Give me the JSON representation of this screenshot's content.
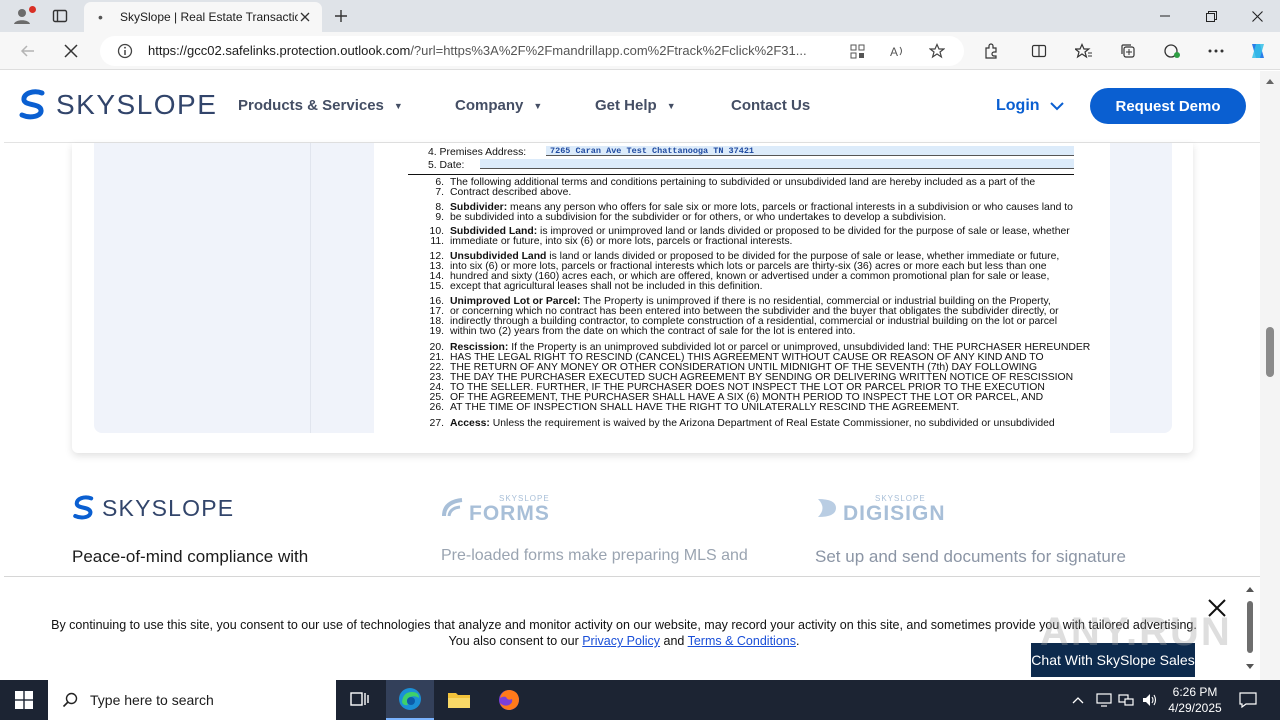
{
  "browser": {
    "tab_title": "SkySlope | Real Estate Transaction",
    "tab_favicon": "•",
    "url_host": "https://gcc02.safelinks.protection.outlook.com",
    "url_rest": "/?url=https%3A%2F%2Fmandrillapp.com%2Ftrack%2Fclick%2F31..."
  },
  "header": {
    "logo_text": "SKYSLOPE",
    "nav": [
      "Products & Services",
      "Company",
      "Get Help",
      "Contact Us"
    ],
    "login_label": "Login",
    "demo_label": "Request Demo",
    "brand_color": "#0a5fd1"
  },
  "doc": {
    "line4_label": "4.   Premises Address:",
    "line4_value": "7265 Caran Ave Test Chattanooga TN 37421",
    "line5_label": "5.   Date:",
    "lines": [
      {
        "n": "6.",
        "t": "The following additional terms and conditions pertaining to subdivided or unsubdivided land are hereby included as a part of the"
      },
      {
        "n": "7.",
        "t": "Contract described above."
      },
      {
        "n": "8.",
        "b": "Subdivider:",
        "t": " means any person who offers for sale six or more lots, parcels or fractional interests in a subdivision or who causes land to"
      },
      {
        "n": "9.",
        "t": "be subdivided into a subdivision for the subdivider or for others, or who undertakes to develop a subdivision."
      },
      {
        "n": "10.",
        "b": "Subdivided Land:",
        "t": " is improved or unimproved land or lands divided or proposed to be divided for the purpose of sale or lease, whether"
      },
      {
        "n": "11.",
        "t": "immediate or future, into six (6) or more lots, parcels or fractional interests."
      },
      {
        "n": "12.",
        "b": "Unsubdivided Land",
        "t": " is land or lands divided or proposed to be divided for the purpose of sale or lease, whether immediate or future,"
      },
      {
        "n": "13.",
        "t": "into six (6) or more lots, parcels or fractional interests which lots or parcels are thirty-six (36) acres or more each but less than one"
      },
      {
        "n": "14.",
        "t": "hundred and sixty (160) acres each, or which are offered, known or advertised under a common promotional plan for sale or lease,"
      },
      {
        "n": "15.",
        "t": "except that agricultural leases shall not be included in this definition."
      },
      {
        "n": "16.",
        "b": "Unimproved Lot or Parcel:",
        "t": " The Property is unimproved if there is no residential, commercial or industrial building on the Property,"
      },
      {
        "n": "17.",
        "t": "or concerning which no contract has been entered into between the subdivider and the buyer that obligates the subdivider directly, or"
      },
      {
        "n": "18.",
        "t": "indirectly through a building contractor, to complete construction of a residential, commercial or industrial building on the lot or parcel"
      },
      {
        "n": "19.",
        "t": "within two (2) years from the date on which the contract of sale for the lot is entered into."
      },
      {
        "n": "20.",
        "b": "Rescission:",
        "t": " If the Property is an unimproved subdivided lot or parcel or unimproved, unsubdivided land: THE PURCHASER HEREUNDER"
      },
      {
        "n": "21.",
        "t": "HAS THE LEGAL RIGHT TO RESCIND (CANCEL) THIS AGREEMENT WITHOUT CAUSE OR REASON OF ANY KIND AND TO"
      },
      {
        "n": "22.",
        "t": "THE RETURN OF ANY MONEY OR OTHER CONSIDERATION UNTIL MIDNIGHT OF THE SEVENTH (7th) DAY FOLLOWING"
      },
      {
        "n": "23.",
        "t": "THE DAY THE PURCHASER EXECUTED SUCH AGREEMENT BY SENDING OR DELIVERING WRITTEN NOTICE OF RESCISSION"
      },
      {
        "n": "24.",
        "t": "TO THE SELLER. FURTHER, IF THE PURCHASER DOES NOT INSPECT THE LOT OR PARCEL PRIOR TO THE EXECUTION"
      },
      {
        "n": "25.",
        "t": "OF THE AGREEMENT, THE PURCHASER SHALL HAVE A SIX (6) MONTH PERIOD TO INSPECT THE LOT OR PARCEL, AND"
      },
      {
        "n": "26.",
        "t": "AT THE TIME OF INSPECTION SHALL HAVE THE RIGHT TO UNILATERALLY RESCIND THE AGREEMENT."
      },
      {
        "n": "27.",
        "b": "Access:",
        "t": " Unless the requirement is waived by the Arizona Department of Real Estate Commissioner, no subdivided or unsubdivided"
      }
    ]
  },
  "products": [
    {
      "logo_small": "",
      "logo_main": "SKYSLOPE",
      "desc": "Peace-of-mind compliance with",
      "color": "#32456b",
      "desc_color": "#1b1b1b"
    },
    {
      "logo_small": "SKYSLOPE",
      "logo_main": "FORMS",
      "desc": "Pre-loaded forms make preparing MLS and",
      "color": "#a8bfd8",
      "desc_color": "#9aa4b1"
    },
    {
      "logo_small": "SKYSLOPE",
      "logo_main": "DIGISIGN",
      "desc": "Set up and send documents for signature",
      "color": "#a8bfd8",
      "desc_color": "#8b95a5"
    }
  ],
  "cookie": {
    "text_1": "By continuing to use this site, you consent to our use of technologies that analyze and monitor activity on our website, may record your activity on this site, and sometimes provide you with tailored advertising. You also consent to our ",
    "privacy": "Privacy Policy",
    "and": " and ",
    "terms": "Terms & Conditions",
    "end": ".",
    "chat_label": "Chat With SkySlope Sales"
  },
  "watermark": "ANY.RUN",
  "taskbar": {
    "search_placeholder": "Type here to search",
    "time": "6:26 PM",
    "date": "4/29/2025"
  }
}
